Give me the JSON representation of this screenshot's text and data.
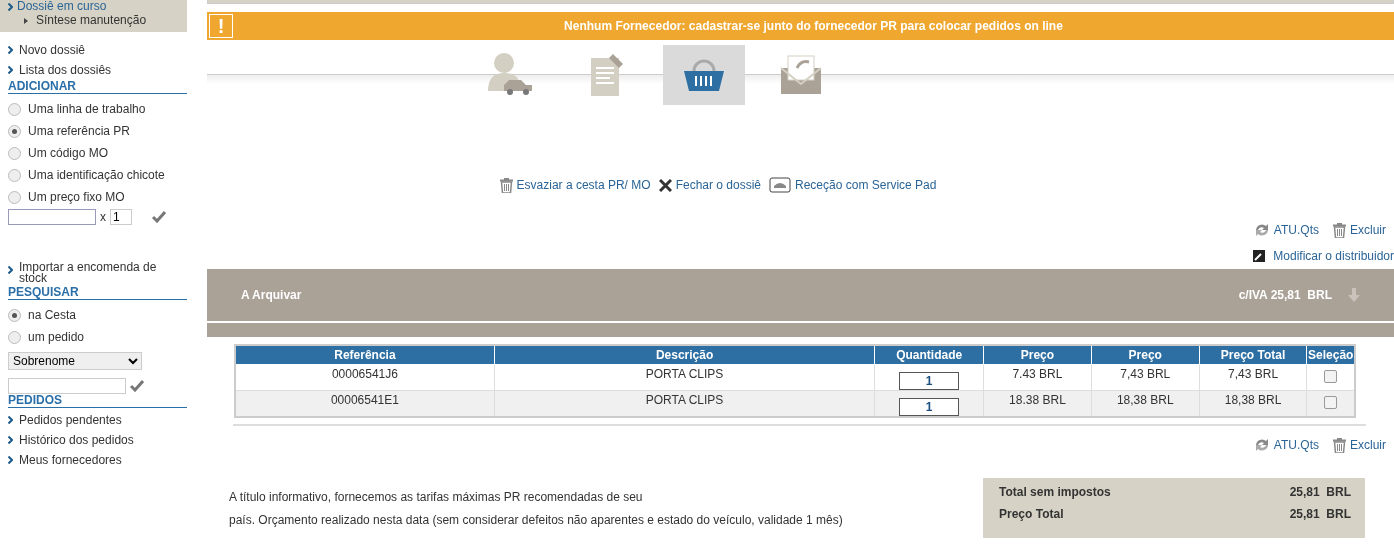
{
  "sidebar": {
    "current_dossier": {
      "title": "Dossiê em curso",
      "items": [
        "Síntese manutenção"
      ]
    },
    "links": [
      "Novo dossiê",
      "Lista dos dossiês"
    ],
    "add": {
      "heading": "ADICIONAR",
      "options": [
        {
          "label": "Uma linha de trabalho",
          "selected": false
        },
        {
          "label": "Uma referência PR",
          "selected": true
        },
        {
          "label": "Um código MO",
          "selected": false
        },
        {
          "label": "Uma identificação chicote",
          "selected": false
        },
        {
          "label": "Um preço fixo MO",
          "selected": false
        }
      ],
      "times": "x",
      "quantity": "1"
    },
    "import_link": "Importar a encomenda de stock",
    "search": {
      "heading": "PESQUISAR",
      "options": [
        {
          "label": "na Cesta",
          "selected": true
        },
        {
          "label": "um pedido",
          "selected": false
        }
      ],
      "select": "Sobrenome"
    },
    "orders": {
      "heading": "PEDIDOS",
      "links": [
        "Pedidos pendentes",
        "Histórico dos pedidos",
        "Meus fornecedores"
      ]
    }
  },
  "alert": {
    "icon": "!",
    "message": "Nenhum Fornecedor: cadastrar-se junto do fornecedor PR para colocar pedidos on line"
  },
  "steps": [
    {
      "kind": "client",
      "selected": false
    },
    {
      "kind": "work",
      "selected": false
    },
    {
      "kind": "basket",
      "selected": true
    },
    {
      "kind": "send",
      "selected": false
    }
  ],
  "actions": [
    {
      "kind": "trash",
      "label": "Esvaziar a cesta PR/ MO"
    },
    {
      "kind": "close",
      "label": "Fechar o dossiê"
    },
    {
      "kind": "pad",
      "label": "Receção com Service Pad"
    }
  ],
  "top_tools": [
    {
      "kind": "refresh",
      "label": "ATU.Qts"
    },
    {
      "kind": "trash",
      "label": "Excluir"
    }
  ],
  "modify_link": "Modificar o distribuidor",
  "band": {
    "title": "A Arquivar",
    "total": "c/IVA 25,81  BRL"
  },
  "table": {
    "columns": [
      "Referência",
      "Descrição",
      "Quantidade",
      "Preço",
      "Preço",
      "Preço Total",
      "Seleção"
    ],
    "rows": [
      {
        "reference": "00006541J6",
        "description": "PORTA CLIPS",
        "quantity": "1",
        "price": "7.43 BRL",
        "price_2": "7,43 BRL",
        "total": "7,43 BRL",
        "selected": false
      },
      {
        "reference": "00006541E1",
        "description": "PORTA CLIPS",
        "quantity": "1",
        "price": "18.38 BRL",
        "price_2": "18,38 BRL",
        "total": "18,38 BRL",
        "selected": false
      }
    ]
  },
  "bottom_tools": [
    {
      "kind": "refresh",
      "label": "ATU.Qts"
    },
    {
      "kind": "trash",
      "label": "Excluir"
    }
  ],
  "note": [
    "A título informativo, fornecemos as tarifas máximas PR recomendadas de seu",
    "país. Orçamento realizado nesta data (sem considerar defeitos não aparentes e estado do veículo, validade 1 mês)"
  ],
  "totals": [
    {
      "label": "Total sem impostos",
      "value": "25,81  BRL"
    },
    {
      "label": "Preço Total",
      "value": "25,81  BRL"
    }
  ]
}
